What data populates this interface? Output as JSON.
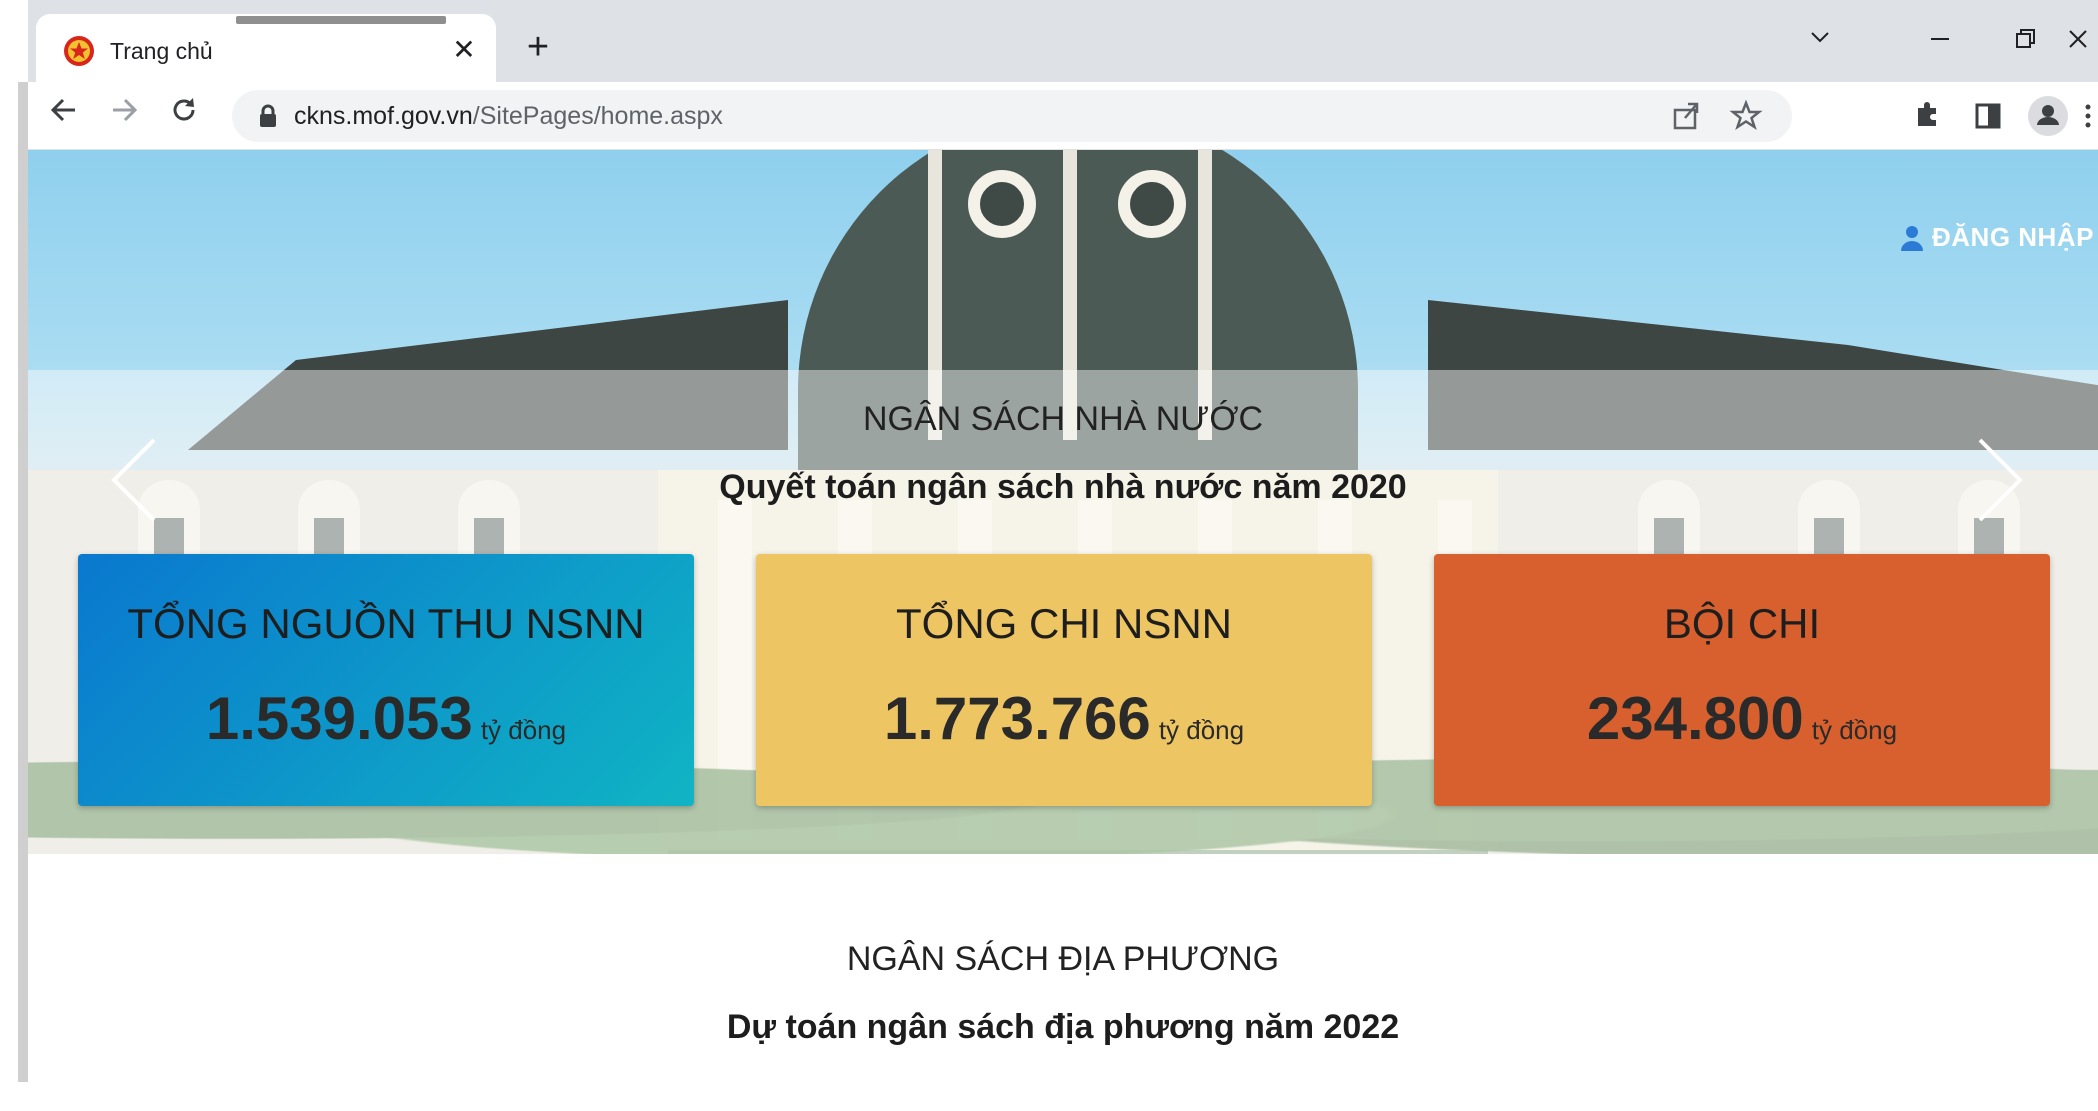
{
  "browser": {
    "tab_title": "Trang chủ",
    "url_host": "ckns.mof.gov.vn",
    "url_path": "/SitePages/home.aspx"
  },
  "hero": {
    "login_label": "ĐĂNG NHẬP",
    "title": "NGÂN SÁCH NHÀ NƯỚC",
    "subtitle": "Quyết toán ngân sách nhà nước năm 2020"
  },
  "cards": [
    {
      "title": "TỔNG NGUỒN THU NSNN",
      "value": "1.539.053",
      "unit": "tỷ đồng",
      "color": "#10a8c8"
    },
    {
      "title": "TỔNG CHI NSNN",
      "value": "1.773.766",
      "unit": "tỷ đồng",
      "color": "#eec563"
    },
    {
      "title": "BỘI CHI",
      "value": "234.800",
      "unit": "tỷ đồng",
      "color": "#d8602e"
    }
  ],
  "local_budget": {
    "title": "NGÂN SÁCH ĐỊA PHƯƠNG",
    "subtitle": "Dự toán ngân sách địa phương năm 2022"
  }
}
